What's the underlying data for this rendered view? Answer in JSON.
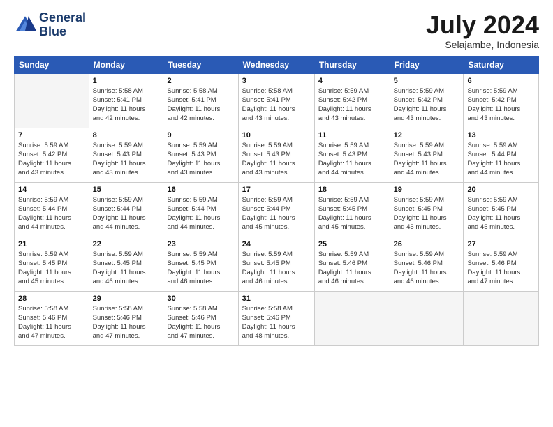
{
  "header": {
    "logo_line1": "General",
    "logo_line2": "Blue",
    "month": "July 2024",
    "location": "Selajambe, Indonesia"
  },
  "days_of_week": [
    "Sunday",
    "Monday",
    "Tuesday",
    "Wednesday",
    "Thursday",
    "Friday",
    "Saturday"
  ],
  "weeks": [
    [
      {
        "day": "",
        "info": ""
      },
      {
        "day": "1",
        "info": "Sunrise: 5:58 AM\nSunset: 5:41 PM\nDaylight: 11 hours\nand 42 minutes."
      },
      {
        "day": "2",
        "info": "Sunrise: 5:58 AM\nSunset: 5:41 PM\nDaylight: 11 hours\nand 42 minutes."
      },
      {
        "day": "3",
        "info": "Sunrise: 5:58 AM\nSunset: 5:41 PM\nDaylight: 11 hours\nand 43 minutes."
      },
      {
        "day": "4",
        "info": "Sunrise: 5:59 AM\nSunset: 5:42 PM\nDaylight: 11 hours\nand 43 minutes."
      },
      {
        "day": "5",
        "info": "Sunrise: 5:59 AM\nSunset: 5:42 PM\nDaylight: 11 hours\nand 43 minutes."
      },
      {
        "day": "6",
        "info": "Sunrise: 5:59 AM\nSunset: 5:42 PM\nDaylight: 11 hours\nand 43 minutes."
      }
    ],
    [
      {
        "day": "7",
        "info": "Sunrise: 5:59 AM\nSunset: 5:42 PM\nDaylight: 11 hours\nand 43 minutes."
      },
      {
        "day": "8",
        "info": "Sunrise: 5:59 AM\nSunset: 5:43 PM\nDaylight: 11 hours\nand 43 minutes."
      },
      {
        "day": "9",
        "info": "Sunrise: 5:59 AM\nSunset: 5:43 PM\nDaylight: 11 hours\nand 43 minutes."
      },
      {
        "day": "10",
        "info": "Sunrise: 5:59 AM\nSunset: 5:43 PM\nDaylight: 11 hours\nand 43 minutes."
      },
      {
        "day": "11",
        "info": "Sunrise: 5:59 AM\nSunset: 5:43 PM\nDaylight: 11 hours\nand 44 minutes."
      },
      {
        "day": "12",
        "info": "Sunrise: 5:59 AM\nSunset: 5:43 PM\nDaylight: 11 hours\nand 44 minutes."
      },
      {
        "day": "13",
        "info": "Sunrise: 5:59 AM\nSunset: 5:44 PM\nDaylight: 11 hours\nand 44 minutes."
      }
    ],
    [
      {
        "day": "14",
        "info": "Sunrise: 5:59 AM\nSunset: 5:44 PM\nDaylight: 11 hours\nand 44 minutes."
      },
      {
        "day": "15",
        "info": "Sunrise: 5:59 AM\nSunset: 5:44 PM\nDaylight: 11 hours\nand 44 minutes."
      },
      {
        "day": "16",
        "info": "Sunrise: 5:59 AM\nSunset: 5:44 PM\nDaylight: 11 hours\nand 44 minutes."
      },
      {
        "day": "17",
        "info": "Sunrise: 5:59 AM\nSunset: 5:44 PM\nDaylight: 11 hours\nand 45 minutes."
      },
      {
        "day": "18",
        "info": "Sunrise: 5:59 AM\nSunset: 5:45 PM\nDaylight: 11 hours\nand 45 minutes."
      },
      {
        "day": "19",
        "info": "Sunrise: 5:59 AM\nSunset: 5:45 PM\nDaylight: 11 hours\nand 45 minutes."
      },
      {
        "day": "20",
        "info": "Sunrise: 5:59 AM\nSunset: 5:45 PM\nDaylight: 11 hours\nand 45 minutes."
      }
    ],
    [
      {
        "day": "21",
        "info": "Sunrise: 5:59 AM\nSunset: 5:45 PM\nDaylight: 11 hours\nand 45 minutes."
      },
      {
        "day": "22",
        "info": "Sunrise: 5:59 AM\nSunset: 5:45 PM\nDaylight: 11 hours\nand 46 minutes."
      },
      {
        "day": "23",
        "info": "Sunrise: 5:59 AM\nSunset: 5:45 PM\nDaylight: 11 hours\nand 46 minutes."
      },
      {
        "day": "24",
        "info": "Sunrise: 5:59 AM\nSunset: 5:45 PM\nDaylight: 11 hours\nand 46 minutes."
      },
      {
        "day": "25",
        "info": "Sunrise: 5:59 AM\nSunset: 5:46 PM\nDaylight: 11 hours\nand 46 minutes."
      },
      {
        "day": "26",
        "info": "Sunrise: 5:59 AM\nSunset: 5:46 PM\nDaylight: 11 hours\nand 46 minutes."
      },
      {
        "day": "27",
        "info": "Sunrise: 5:59 AM\nSunset: 5:46 PM\nDaylight: 11 hours\nand 47 minutes."
      }
    ],
    [
      {
        "day": "28",
        "info": "Sunrise: 5:58 AM\nSunset: 5:46 PM\nDaylight: 11 hours\nand 47 minutes."
      },
      {
        "day": "29",
        "info": "Sunrise: 5:58 AM\nSunset: 5:46 PM\nDaylight: 11 hours\nand 47 minutes."
      },
      {
        "day": "30",
        "info": "Sunrise: 5:58 AM\nSunset: 5:46 PM\nDaylight: 11 hours\nand 47 minutes."
      },
      {
        "day": "31",
        "info": "Sunrise: 5:58 AM\nSunset: 5:46 PM\nDaylight: 11 hours\nand 48 minutes."
      },
      {
        "day": "",
        "info": ""
      },
      {
        "day": "",
        "info": ""
      },
      {
        "day": "",
        "info": ""
      }
    ]
  ]
}
